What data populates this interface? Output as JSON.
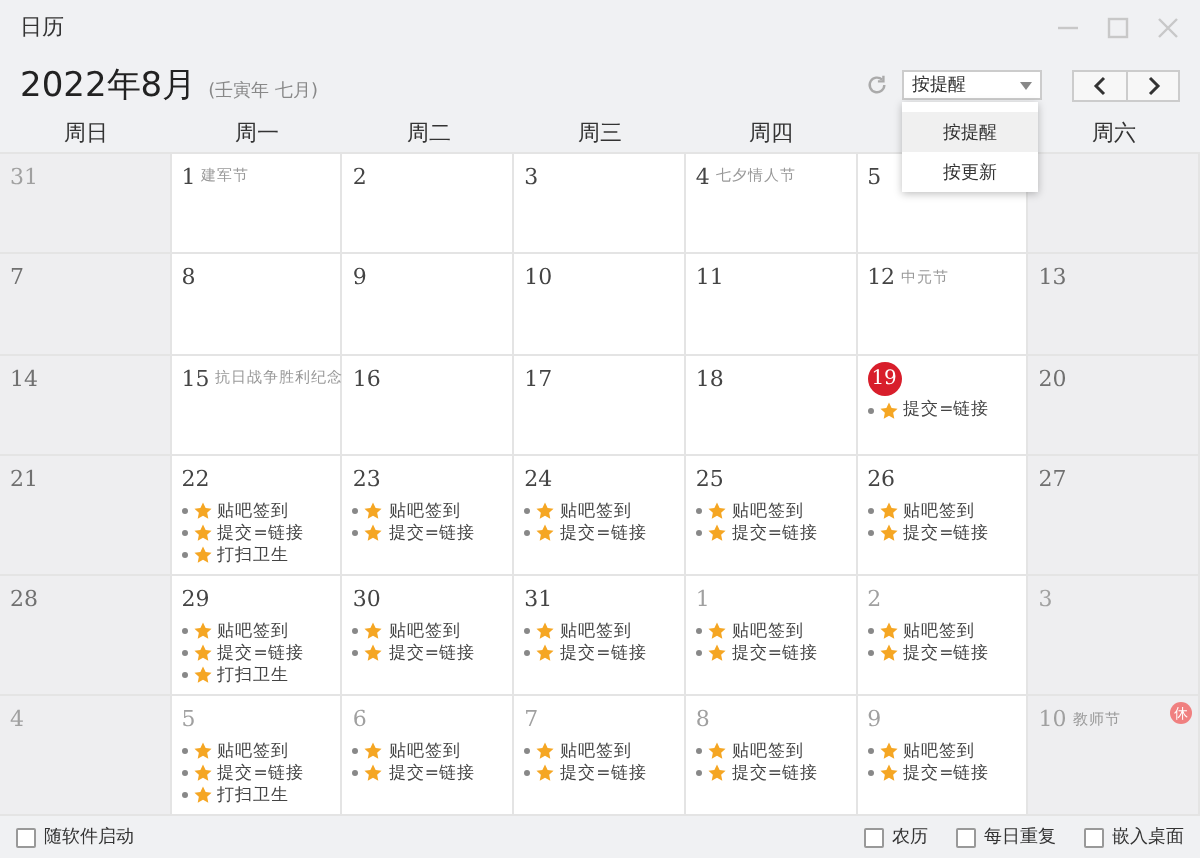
{
  "window": {
    "title": "日历"
  },
  "header": {
    "month": "2022年8月",
    "lunar": "(壬寅年 七月)",
    "sort_select": {
      "value": "按提醒",
      "expanded": true,
      "options": [
        {
          "label": "按提醒",
          "selected": true
        },
        {
          "label": "按更新",
          "selected": false
        }
      ]
    }
  },
  "weekdays": [
    {
      "label": "周日"
    },
    {
      "label": "周一"
    },
    {
      "label": "周二"
    },
    {
      "label": "周三"
    },
    {
      "label": "周四"
    },
    {
      "label": "周六"
    }
  ],
  "weeks": [
    [
      {
        "day": "31",
        "weekend": true,
        "other_month": true
      },
      {
        "day": "1",
        "note": "建军节",
        "weekend": false,
        "other_month": false
      },
      {
        "day": "2",
        "weekend": false,
        "other_month": false
      },
      {
        "day": "3",
        "weekend": false,
        "other_month": false
      },
      {
        "day": "4",
        "note": "七夕情人节",
        "weekend": false,
        "other_month": false
      },
      {
        "day": "5",
        "weekend": false,
        "other_month": false
      },
      {
        "weekend": true
      }
    ],
    [
      {
        "day": "7",
        "weekend": true,
        "other_month": false
      },
      {
        "day": "8",
        "weekend": false,
        "other_month": false
      },
      {
        "day": "9",
        "weekend": false,
        "other_month": false
      },
      {
        "day": "10",
        "weekend": false,
        "other_month": false
      },
      {
        "day": "11",
        "weekend": false,
        "other_month": false
      },
      {
        "day": "12",
        "note": "中元节",
        "weekend": false,
        "other_month": false
      },
      {
        "day": "13",
        "weekend": true,
        "other_month": false
      }
    ],
    [
      {
        "day": "14",
        "weekend": true,
        "other_month": false
      },
      {
        "day": "15",
        "note": "抗日战争胜利纪念",
        "weekend": false,
        "other_month": false
      },
      {
        "day": "16",
        "weekend": false,
        "other_month": false
      },
      {
        "day": "17",
        "weekend": false,
        "other_month": false
      },
      {
        "day": "18",
        "weekend": false,
        "other_month": false
      },
      {
        "day": "19",
        "today": true,
        "weekend": false,
        "other_month": false,
        "events": [
          "提交=链接"
        ]
      },
      {
        "day": "20",
        "weekend": true,
        "other_month": false
      }
    ],
    [
      {
        "day": "21",
        "weekend": true,
        "other_month": false
      },
      {
        "day": "22",
        "weekend": false,
        "other_month": false,
        "events": [
          "贴吧签到",
          "提交=链接",
          "打扫卫生"
        ]
      },
      {
        "day": "23",
        "weekend": false,
        "other_month": false,
        "events": [
          "贴吧签到",
          "提交=链接"
        ]
      },
      {
        "day": "24",
        "weekend": false,
        "other_month": false,
        "events": [
          "贴吧签到",
          "提交=链接"
        ]
      },
      {
        "day": "25",
        "weekend": false,
        "other_month": false,
        "events": [
          "贴吧签到",
          "提交=链接"
        ]
      },
      {
        "day": "26",
        "weekend": false,
        "other_month": false,
        "events": [
          "贴吧签到",
          "提交=链接"
        ]
      },
      {
        "day": "27",
        "weekend": true,
        "other_month": false
      }
    ],
    [
      {
        "day": "28",
        "weekend": true,
        "other_month": false
      },
      {
        "day": "29",
        "weekend": false,
        "other_month": false,
        "events": [
          "贴吧签到",
          "提交=链接",
          "打扫卫生"
        ]
      },
      {
        "day": "30",
        "weekend": false,
        "other_month": false,
        "events": [
          "贴吧签到",
          "提交=链接"
        ]
      },
      {
        "day": "31",
        "weekend": false,
        "other_month": false,
        "events": [
          "贴吧签到",
          "提交=链接"
        ]
      },
      {
        "day": "1",
        "weekend": false,
        "other_month": true,
        "events": [
          "贴吧签到",
          "提交=链接"
        ]
      },
      {
        "day": "2",
        "weekend": false,
        "other_month": true,
        "events": [
          "贴吧签到",
          "提交=链接"
        ]
      },
      {
        "day": "3",
        "weekend": true,
        "other_month": true
      }
    ],
    [
      {
        "day": "4",
        "weekend": true,
        "other_month": true
      },
      {
        "day": "5",
        "weekend": false,
        "other_month": true,
        "events": [
          "贴吧签到",
          "提交=链接",
          "打扫卫生"
        ]
      },
      {
        "day": "6",
        "weekend": false,
        "other_month": true,
        "events": [
          "贴吧签到",
          "提交=链接"
        ]
      },
      {
        "day": "7",
        "weekend": false,
        "other_month": true,
        "events": [
          "贴吧签到",
          "提交=链接"
        ]
      },
      {
        "day": "8",
        "weekend": false,
        "other_month": true,
        "events": [
          "贴吧签到",
          "提交=链接"
        ]
      },
      {
        "day": "9",
        "weekend": false,
        "other_month": true,
        "events": [
          "贴吧签到",
          "提交=链接"
        ]
      },
      {
        "day": "10",
        "note": "教师节",
        "badge": "休",
        "weekend": true,
        "other_month": true
      }
    ]
  ],
  "footer": {
    "left": [
      {
        "label": "随软件启动",
        "checked": false
      }
    ],
    "right": [
      {
        "label": "农历",
        "checked": false
      },
      {
        "label": "每日重复",
        "checked": false
      },
      {
        "label": "嵌入桌面",
        "checked": false
      }
    ]
  }
}
